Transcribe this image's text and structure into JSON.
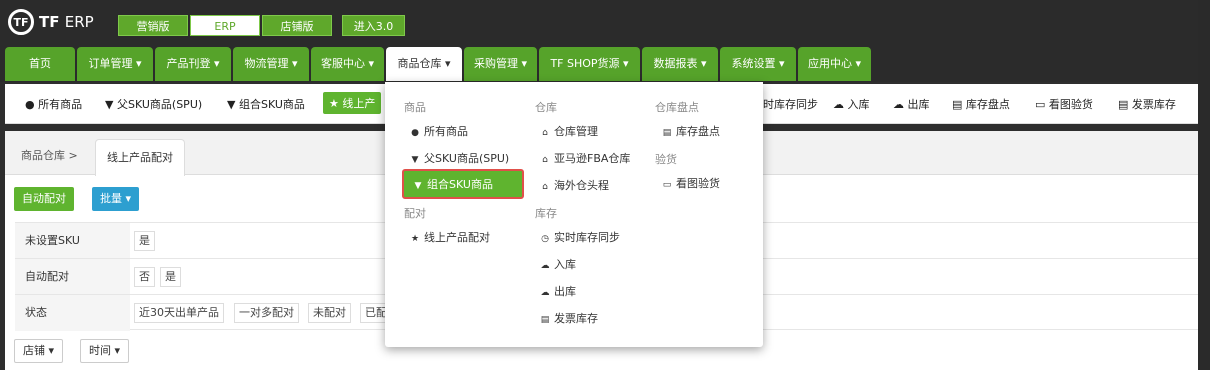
{
  "logo": {
    "mark": "TF",
    "brand": "TF",
    "product": "ERP"
  },
  "modes": [
    "营销版",
    "ERP",
    "店铺版",
    "进入3.0"
  ],
  "nav": [
    "首页",
    "订单管理 ▾",
    "产品刊登 ▾",
    "物流管理 ▾",
    "客服中心 ▾",
    "商品仓库 ▾",
    "采购管理 ▾",
    "TF SHOP货源 ▾",
    "数据报表 ▾",
    "系统设置 ▾",
    "应用中心 ▾"
  ],
  "subnav": [
    "● 所有商品",
    "▼ 父SKU商品(SPU)",
    "▼ 组合SKU商品",
    "★ 线上产",
    "时库存同步",
    "☁ 入库",
    "☁ 出库",
    "▤ 库存盘点",
    "▭ 看图验货",
    "▤ 发票库存"
  ],
  "breadcrumb": {
    "root": "商品仓库",
    "sep": ">",
    "tab": "线上产品配对"
  },
  "buttons": {
    "auto": "自动配对",
    "batch": "批量 ▾"
  },
  "filters": [
    {
      "label": "未设置SKU",
      "options": [
        "是"
      ]
    },
    {
      "label": "自动配对",
      "options": [
        "否",
        "是"
      ]
    },
    {
      "label": "状态",
      "options": [
        "近30天出单产品",
        "一对多配对",
        "未配对",
        "已配"
      ]
    }
  ],
  "dropdowns": [
    "店铺 ▾",
    "时间 ▾"
  ],
  "menu": {
    "col1": {
      "head1": "商品",
      "items1": [
        "所有商品",
        "父SKU商品(SPU)",
        "组合SKU商品"
      ],
      "head2": "配对",
      "items2": [
        "线上产品配对"
      ]
    },
    "col2": {
      "head1": "仓库",
      "items1": [
        "仓库管理",
        "亚马逊FBA仓库",
        "海外仓头程"
      ],
      "head2": "库存",
      "items2": [
        "实时库存同步",
        "入库",
        "出库",
        "发票库存"
      ]
    },
    "col3": {
      "head1": "仓库盘点",
      "items1": [
        "库存盘点"
      ],
      "head2": "验货",
      "items2": [
        "看图验货"
      ]
    }
  },
  "colors": {
    "green": "#5fb42f",
    "nav_green": "#56a32a",
    "highlight_border": "#e0504a",
    "blue": "#2d9fd0"
  }
}
